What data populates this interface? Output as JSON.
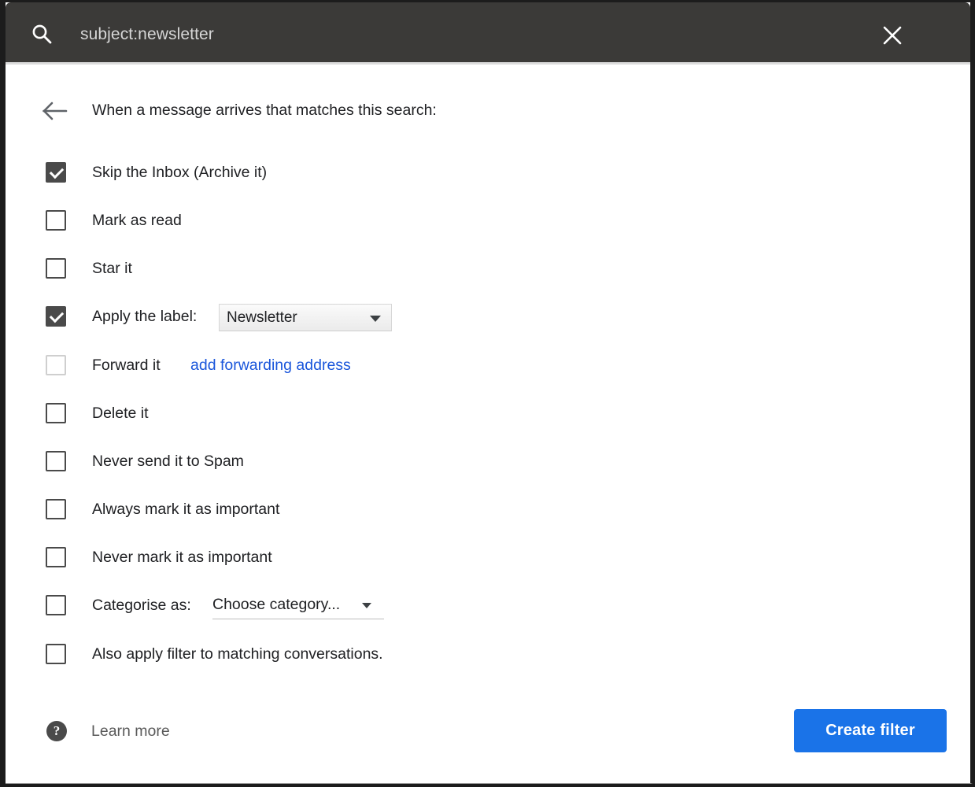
{
  "search": {
    "icon": "search-icon",
    "query": "subject:newsletter",
    "close_icon": "close-icon"
  },
  "dialog": {
    "back_icon": "arrow-left-icon",
    "heading": "When a message arrives that matches this search:",
    "options": [
      {
        "label": "Skip the Inbox (Archive it)",
        "checked": true,
        "disabled": false
      },
      {
        "label": "Mark as read",
        "checked": false,
        "disabled": false
      },
      {
        "label": "Star it",
        "checked": false,
        "disabled": false
      },
      {
        "label": "Apply the label:",
        "checked": true,
        "disabled": false
      },
      {
        "label": "Forward it",
        "checked": false,
        "disabled": true
      },
      {
        "label": "Delete it",
        "checked": false,
        "disabled": false
      },
      {
        "label": "Never send it to Spam",
        "checked": false,
        "disabled": false
      },
      {
        "label": "Always mark it as important",
        "checked": false,
        "disabled": false
      },
      {
        "label": "Never mark it as important",
        "checked": false,
        "disabled": false
      },
      {
        "label": "Categorise as:",
        "checked": false,
        "disabled": false
      },
      {
        "label": "Also apply filter to matching conversations.",
        "checked": false,
        "disabled": false
      }
    ],
    "label_select": {
      "value": "Newsletter",
      "arrow_icon": "triangle-down-icon"
    },
    "forward_link": "add forwarding address",
    "category_select": {
      "value": "Choose category...",
      "arrow_icon": "triangle-down-icon"
    },
    "footer": {
      "help_icon": "help-circle-icon",
      "help_glyph": "?",
      "learn_more": "Learn more",
      "primary_button": "Create filter"
    }
  },
  "colors": {
    "header_bg": "#3b3a38",
    "accent": "#1a73e8",
    "link": "#1a56db",
    "checkbox": "#4a4a4a",
    "text": "#202124",
    "muted_text": "#5a5a5a"
  }
}
